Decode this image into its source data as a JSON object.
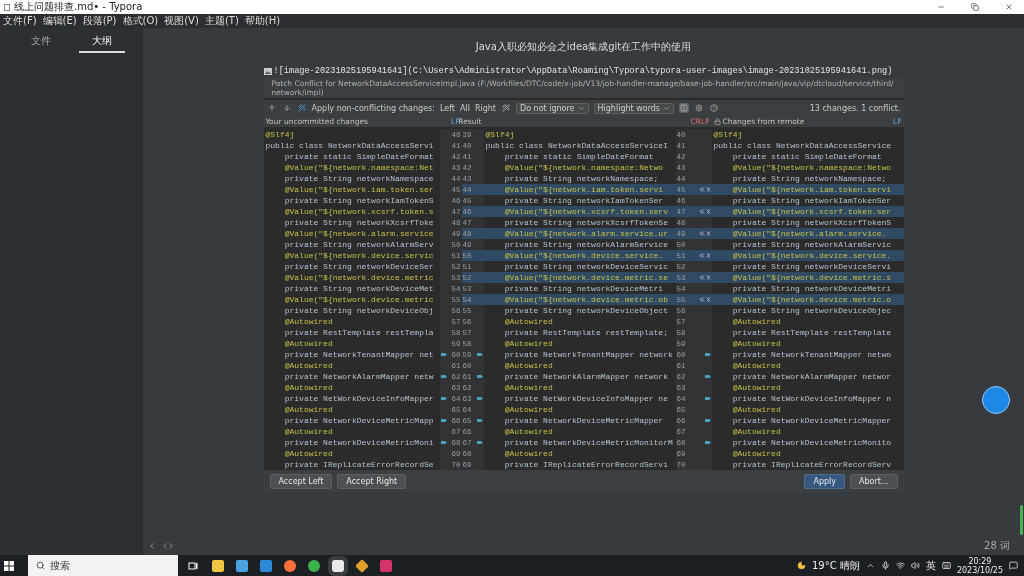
{
  "window": {
    "title": "线上问题排查.md• - Typora"
  },
  "menu": [
    "文件(F)",
    "编辑(E)",
    "段落(P)",
    "格式(O)",
    "视图(V)",
    "主题(T)",
    "帮助(H)"
  ],
  "sidebar": {
    "tabs": [
      {
        "label": "文件",
        "selected": false
      },
      {
        "label": "大纲",
        "selected": true
      }
    ]
  },
  "document": {
    "heading": "Java入职必知必会之idea集成git在工作中的使用",
    "image_source": "![image-20231025195941641](C:\\Users\\Administrator\\AppData\\Roaming\\Typora\\typora-user-images\\image-20231025195941641.png)"
  },
  "merge_dialog": {
    "title": "Patch Conflict for NetworkDataAccessServiceImpl.java (F:/Workfiles/DTC/code/x-job/V13/job-handler-manage/base-job-handler/src/main/java/vip/dtcloud/service/third/network/impl)",
    "apply_label": "Apply non-conflicting changes:",
    "apply_left": "Left",
    "apply_all": "All",
    "apply_right": "Right",
    "ignore_select": "Do not ignore",
    "highlight_select": "Highlight words",
    "summary": "13 changes. 1 conflict.",
    "panes": [
      {
        "title": "Your uncommitted changes",
        "separator": "LF"
      },
      {
        "title": "Result",
        "separator": "CRLF"
      },
      {
        "title": "Changes from remote",
        "separator": "LF"
      }
    ],
    "rows": [
      {
        "kind": "annotation",
        "changed": false,
        "marker": false,
        "l": "@Slf4j",
        "ln": "40",
        "rln": "39",
        "r": "@Slf4j",
        "rrn": "40",
        "rt": "@Slf4j"
      },
      {
        "kind": "code",
        "changed": false,
        "marker": false,
        "l": "public class NetworkDataAccessServi",
        "ln": "41",
        "rln": "40",
        "r": "public class NetworkDataAccessServiceI",
        "rrn": "41",
        "rt": "public class NetworkDataAccessService"
      },
      {
        "kind": "code",
        "changed": false,
        "marker": false,
        "l": "    private static SimpleDateFormat",
        "ln": "42",
        "rln": "41",
        "r": "    private static SimpleDateFormat",
        "rrn": "42",
        "rt": "    private static SimpleDateFormat"
      },
      {
        "kind": "annotation",
        "changed": false,
        "marker": false,
        "l": "    @Value(\"${network.namespace:Net",
        "ln": "43",
        "rln": "42",
        "r": "    @Value(\"${network.namespace:Netwo",
        "rrn": "43",
        "rt": "    @Value(\"${network.namespace:Netwo"
      },
      {
        "kind": "code",
        "changed": false,
        "marker": false,
        "l": "    private String networkNamespace",
        "ln": "44",
        "rln": "43",
        "r": "    private String networkNamespace;",
        "rrn": "44",
        "rt": "    private String networkNamespace;"
      },
      {
        "kind": "annotation",
        "changed": true,
        "marker": false,
        "l": "    @Value(\"${network.iam.token.ser",
        "ln": "45",
        "rln": "44",
        "r": "    @Value(\"${network.iam.token.servi",
        "rrn": "45",
        "rt": "    @Value(\"${network.iam.token.servi"
      },
      {
        "kind": "code",
        "changed": false,
        "marker": false,
        "l": "    private String networkIamTokenS",
        "ln": "46",
        "rln": "45",
        "r": "    private String networkIamTokenSer",
        "rrn": "46",
        "rt": "    private String networkIamTokenSer"
      },
      {
        "kind": "annotation",
        "changed": true,
        "marker": false,
        "l": "    @Value(\"${network.xcsrf.token.s",
        "ln": "47",
        "rln": "46",
        "r": "    @Value(\"${network.xcsrf.token.serv",
        "rrn": "47",
        "rt": "    @Value(\"${network.xcsrf.token.ser"
      },
      {
        "kind": "code",
        "changed": false,
        "marker": false,
        "l": "    private String networkXcsrfToke",
        "ln": "48",
        "rln": "47",
        "r": "    private String networkXcsrfTokenSe",
        "rrn": "48",
        "rt": "    private String networkXcsrfTokenS"
      },
      {
        "kind": "annotation",
        "changed": true,
        "marker": false,
        "l": "    @Value(\"${network.alarm.service",
        "ln": "49",
        "rln": "48",
        "r": "    @Value(\"${network.alarm.service.ur",
        "rrn": "49",
        "rt": "    @Value(\"${network.alarm.service."
      },
      {
        "kind": "code",
        "changed": false,
        "marker": false,
        "l": "    private String networkAlarmServ",
        "ln": "50",
        "rln": "49",
        "r": "    private String networkAlarmService",
        "rrn": "50",
        "rt": "    private String networkAlarmServic"
      },
      {
        "kind": "annotation",
        "changed": true,
        "marker": false,
        "l": "    @Value(\"${network.device.servic",
        "ln": "51",
        "rln": "50",
        "r": "    @Value(\"${network.device.service.",
        "rrn": "51",
        "rt": "    @Value(\"${network.device.service."
      },
      {
        "kind": "code",
        "changed": false,
        "marker": false,
        "l": "    private String networkDeviceSer",
        "ln": "52",
        "rln": "51",
        "r": "    private String networkDeviceServic",
        "rrn": "52",
        "rt": "    private String networkDeviceServi"
      },
      {
        "kind": "annotation",
        "changed": true,
        "marker": false,
        "l": "    @Value(\"${network.device.metric",
        "ln": "53",
        "rln": "52",
        "r": "    @Value(\"${network.device.metric.se",
        "rrn": "53",
        "rt": "    @Value(\"${network.device.metric.s"
      },
      {
        "kind": "code",
        "changed": false,
        "marker": false,
        "l": "    private String networkDeviceMet",
        "ln": "54",
        "rln": "53",
        "r": "    private String networkDeviceMetri",
        "rrn": "54",
        "rt": "    private String networkDeviceMetri"
      },
      {
        "kind": "annotation",
        "changed": true,
        "marker": false,
        "l": "    @Value(\"${network.device.metric",
        "ln": "55",
        "rln": "54",
        "r": "    @Value(\"${network.device.metric.ob",
        "rrn": "55",
        "rt": "    @Value(\"${network.device.metric.o"
      },
      {
        "kind": "code",
        "changed": false,
        "marker": false,
        "l": "    private String networkDeviceObj",
        "ln": "56",
        "rln": "55",
        "r": "    private String networkDeviceObject",
        "rrn": "56",
        "rt": "    private String networkDeviceObjec"
      },
      {
        "kind": "annotation",
        "changed": false,
        "marker": false,
        "l": "    @Autowired",
        "ln": "57",
        "rln": "56",
        "r": "    @Autowired",
        "rrn": "57",
        "rt": "    @Autowired"
      },
      {
        "kind": "code",
        "changed": false,
        "marker": false,
        "l": "    private RestTemplate restTempla",
        "ln": "58",
        "rln": "57",
        "r": "    private RestTemplate restTemplate;",
        "rrn": "58",
        "rt": "    private RestTemplate restTemplate"
      },
      {
        "kind": "annotation",
        "changed": false,
        "marker": false,
        "l": "    @Autowired",
        "ln": "59",
        "rln": "58",
        "r": "    @Autowired",
        "rrn": "59",
        "rt": "    @Autowired"
      },
      {
        "kind": "code",
        "changed": false,
        "marker": true,
        "l": "    private NetworkTenantMapper net",
        "ln": "60",
        "rln": "59",
        "r": "    private NetworkTenantMapper network",
        "rrn": "60",
        "rt": "    private NetworkTenantMapper netwo"
      },
      {
        "kind": "annotation",
        "changed": false,
        "marker": false,
        "l": "    @Autowired",
        "ln": "61",
        "rln": "60",
        "r": "    @Autowired",
        "rrn": "61",
        "rt": "    @Autowired"
      },
      {
        "kind": "code",
        "changed": false,
        "marker": true,
        "l": "    private NetworkAlarmMapper netw",
        "ln": "62",
        "rln": "61",
        "r": "    private NetworkAlarmMapper network",
        "rrn": "62",
        "rt": "    private NetworkAlarmMapper networ"
      },
      {
        "kind": "annotation",
        "changed": false,
        "marker": false,
        "l": "    @Autowired",
        "ln": "63",
        "rln": "62",
        "r": "    @Autowired",
        "rrn": "63",
        "rt": "    @Autowired"
      },
      {
        "kind": "code",
        "changed": false,
        "marker": true,
        "l": "    private NetWorkDeviceInfoMapper",
        "ln": "64",
        "rln": "63",
        "r": "    private NetWorkDeviceInfoMapper ne",
        "rrn": "64",
        "rt": "    private NetWorkDeviceInfoMapper n"
      },
      {
        "kind": "annotation",
        "changed": false,
        "marker": false,
        "l": "    @Autowired",
        "ln": "65",
        "rln": "64",
        "r": "    @Autowired",
        "rrn": "65",
        "rt": "    @Autowired"
      },
      {
        "kind": "code",
        "changed": false,
        "marker": true,
        "l": "    private NetworkDeviceMetricMapp",
        "ln": "66",
        "rln": "65",
        "r": "    private NetworkDeviceMetricMapper",
        "rrn": "66",
        "rt": "    private NetworkDeviceMetricMapper"
      },
      {
        "kind": "annotation",
        "changed": false,
        "marker": false,
        "l": "    @Autowired",
        "ln": "67",
        "rln": "66",
        "r": "    @Autowired",
        "rrn": "67",
        "rt": "    @Autowired"
      },
      {
        "kind": "code",
        "changed": false,
        "marker": true,
        "l": "    private NetworkDeviceMetricMoni",
        "ln": "68",
        "rln": "67",
        "r": "    private NetworkDeviceMetricMonitorM",
        "rrn": "68",
        "rt": "    private NetworkDeviceMetricMonito"
      },
      {
        "kind": "annotation",
        "changed": false,
        "marker": false,
        "l": "    @Autowired",
        "ln": "69",
        "rln": "68",
        "r": "    @Autowired",
        "rrn": "69",
        "rt": "    @Autowired"
      },
      {
        "kind": "code",
        "changed": false,
        "marker": false,
        "l": "    private IReplicateErrorRecordSe",
        "ln": "70",
        "rln": "69",
        "r": "    private IReplicateErrorRecordServi",
        "rrn": "70",
        "rt": "    private IReplicateErrorRecordServ"
      }
    ],
    "buttons": [
      {
        "label": "Accept Left",
        "primary": false
      },
      {
        "label": "Accept Right",
        "primary": false
      },
      {
        "label": "Apply",
        "primary": true
      },
      {
        "label": "Abort...",
        "primary": false
      }
    ]
  },
  "status_bar": {
    "word_count": "28 词"
  },
  "taskbar": {
    "search_placeholder": "搜索",
    "weather": "19°C 晴朗",
    "ime": "英",
    "time": "20:29",
    "date": "2023/10/25"
  }
}
